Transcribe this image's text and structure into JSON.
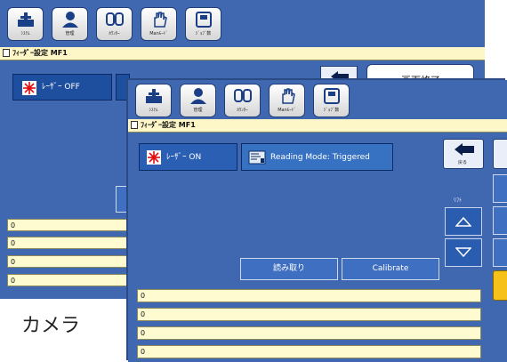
{
  "toolbar": {
    "buttons": [
      {
        "label": "ｼｽﾃﾑ",
        "icon": "system-icon"
      },
      {
        "label": "管理",
        "icon": "user-icon"
      },
      {
        "label": "ｶｳﾝﾀｰ",
        "icon": "counter-icon"
      },
      {
        "label": "Manﾓｰﾄﾞ",
        "icon": "hand-icon"
      },
      {
        "label": "ｼﾞｮﾌﾞ数",
        "icon": "job-icon"
      }
    ]
  },
  "back_window": {
    "title": "ﾌｨｰﾀﾞｰ設定 MF1",
    "laser_label": "ﾚｰｻﾞｰ OFF",
    "exit_label": "画面終了",
    "fields": [
      "0",
      "0",
      "0",
      "0"
    ]
  },
  "front_window": {
    "title": "ﾌｨｰﾀﾞｰ設定 MF1",
    "laser_label": "ﾚｰｻﾞｰ ON",
    "reading_mode_label": "Reading Mode: Triggered",
    "back_label": "戻る",
    "lift_label": "ﾘﾌﾄ",
    "read_button": "読み取り",
    "calibrate_button": "Calibrate",
    "fields": [
      "0",
      "0",
      "0",
      "0"
    ]
  },
  "camera_label": "カメラ",
  "colors": {
    "window_bg": "#3f68b0",
    "title_bg": "#fdf6c6",
    "field_bg": "#fffbd0",
    "accent_yellow": "#f6c21a"
  }
}
